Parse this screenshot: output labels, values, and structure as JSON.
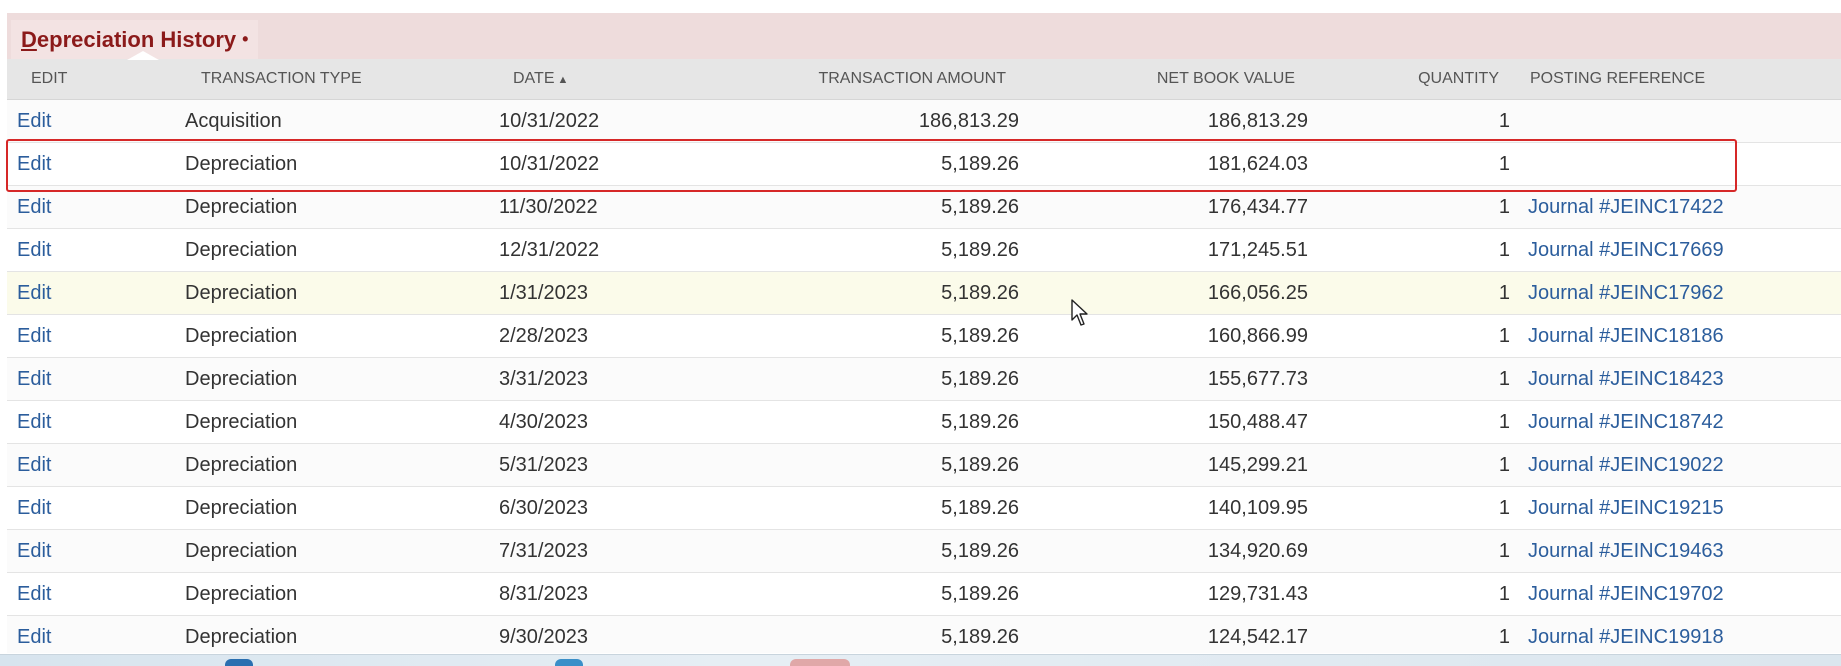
{
  "section": {
    "title": "Depreciation History",
    "bullet": "•"
  },
  "columns": {
    "edit": "EDIT",
    "transaction_type": "TRANSACTION TYPE",
    "date": "DATE",
    "date_sort_indicator": "▲",
    "transaction_amount": "TRANSACTION AMOUNT",
    "net_book_value": "NET BOOK VALUE",
    "quantity": "QUANTITY",
    "posting_reference": "POSTING REFERENCE"
  },
  "rows": [
    {
      "edit": "Edit",
      "type": "Acquisition",
      "date": "10/31/2022",
      "amount": "186,813.29",
      "nbv": "186,813.29",
      "qty": "1",
      "ref": ""
    },
    {
      "edit": "Edit",
      "type": "Depreciation",
      "date": "10/31/2022",
      "amount": "5,189.26",
      "nbv": "181,624.03",
      "qty": "1",
      "ref": ""
    },
    {
      "edit": "Edit",
      "type": "Depreciation",
      "date": "11/30/2022",
      "amount": "5,189.26",
      "nbv": "176,434.77",
      "qty": "1",
      "ref": "Journal #JEINC17422"
    },
    {
      "edit": "Edit",
      "type": "Depreciation",
      "date": "12/31/2022",
      "amount": "5,189.26",
      "nbv": "171,245.51",
      "qty": "1",
      "ref": "Journal #JEINC17669"
    },
    {
      "edit": "Edit",
      "type": "Depreciation",
      "date": "1/31/2023",
      "amount": "5,189.26",
      "nbv": "166,056.25",
      "qty": "1",
      "ref": "Journal #JEINC17962"
    },
    {
      "edit": "Edit",
      "type": "Depreciation",
      "date": "2/28/2023",
      "amount": "5,189.26",
      "nbv": "160,866.99",
      "qty": "1",
      "ref": "Journal #JEINC18186"
    },
    {
      "edit": "Edit",
      "type": "Depreciation",
      "date": "3/31/2023",
      "amount": "5,189.26",
      "nbv": "155,677.73",
      "qty": "1",
      "ref": "Journal #JEINC18423"
    },
    {
      "edit": "Edit",
      "type": "Depreciation",
      "date": "4/30/2023",
      "amount": "5,189.26",
      "nbv": "150,488.47",
      "qty": "1",
      "ref": "Journal #JEINC18742"
    },
    {
      "edit": "Edit",
      "type": "Depreciation",
      "date": "5/31/2023",
      "amount": "5,189.26",
      "nbv": "145,299.21",
      "qty": "1",
      "ref": "Journal #JEINC19022"
    },
    {
      "edit": "Edit",
      "type": "Depreciation",
      "date": "6/30/2023",
      "amount": "5,189.26",
      "nbv": "140,109.95",
      "qty": "1",
      "ref": "Journal #JEINC19215"
    },
    {
      "edit": "Edit",
      "type": "Depreciation",
      "date": "7/31/2023",
      "amount": "5,189.26",
      "nbv": "134,920.69",
      "qty": "1",
      "ref": "Journal #JEINC19463"
    },
    {
      "edit": "Edit",
      "type": "Depreciation",
      "date": "8/31/2023",
      "amount": "5,189.26",
      "nbv": "129,731.43",
      "qty": "1",
      "ref": "Journal #JEINC19702"
    },
    {
      "edit": "Edit",
      "type": "Depreciation",
      "date": "9/30/2023",
      "amount": "5,189.26",
      "nbv": "124,542.17",
      "qty": "1",
      "ref": "Journal #JEINC19918"
    }
  ],
  "colors": {
    "header_band": "#eedcdc",
    "title_text": "#8b1a1a",
    "link": "#2b5d9c",
    "highlight_border": "#d62828",
    "hover_row": "#fbfbea"
  }
}
